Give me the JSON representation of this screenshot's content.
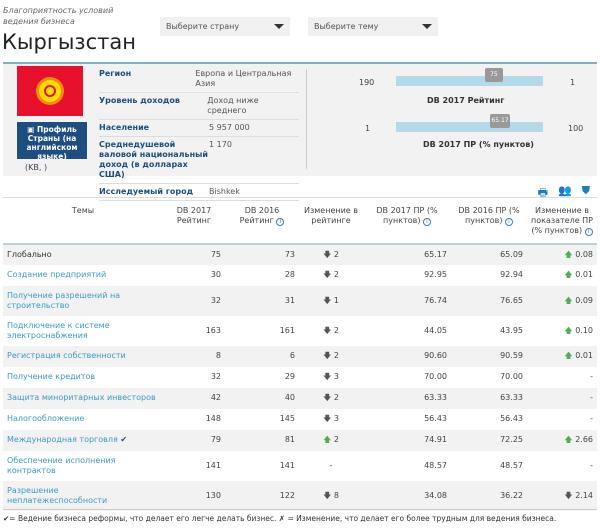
{
  "header": {
    "subtitle": "Благоприятность условий ведения бизнеса",
    "title": "Кыргызстан",
    "country_select": "Выберите страну",
    "topic_select": "Выберите тему"
  },
  "profile": {
    "button": "Профиль Страны (на английском языке)",
    "code": "(KB, )",
    "rows": [
      {
        "k": "Регион",
        "v": "Европа и Центральная Азия"
      },
      {
        "k": "Уровень доходов",
        "v": "Доход ниже среднего"
      },
      {
        "k": "Население",
        "v": "5 957 000"
      },
      {
        "k": "Среднедушевой валовой национальный доход (в долларах США)",
        "v": "1 170"
      },
      {
        "k": "Исследуемый город",
        "v": "Bishkek"
      }
    ]
  },
  "rank_bar": {
    "min": "190",
    "max": "1",
    "value": "75",
    "label": "DB 2017 Рейтинг"
  },
  "score_bar": {
    "min": "1",
    "max": "100",
    "value": "65.17",
    "label": "DB 2017 ПР (% пунктов)"
  },
  "table": {
    "headers": [
      "Темы",
      "DB 2017 Рейтинг",
      "DB 2016 Рейтинг",
      "Изменение в рейтинге",
      "DB 2017 ПР (% пунктов)",
      "DB 2016 ПР (% пунктов)",
      "Изменение в показателе ПР (% пунктов)"
    ],
    "rows": [
      {
        "t": "Глобально",
        "r17": "75",
        "r16": "73",
        "dir": "down",
        "ch": "2",
        "p17": "65.17",
        "p16": "65.09",
        "pdir": "up",
        "pch": "0.08"
      },
      {
        "t": "Создание предприятий",
        "r17": "30",
        "r16": "28",
        "dir": "down",
        "ch": "2",
        "p17": "92.95",
        "p16": "92.94",
        "pdir": "up",
        "pch": "0.01"
      },
      {
        "t": "Получение разрешений на строительство",
        "r17": "32",
        "r16": "31",
        "dir": "down",
        "ch": "1",
        "p17": "76.74",
        "p16": "76.65",
        "pdir": "up",
        "pch": "0.09"
      },
      {
        "t": "Подключение к системе электроснабжения",
        "r17": "163",
        "r16": "161",
        "dir": "down",
        "ch": "2",
        "p17": "44.05",
        "p16": "43.95",
        "pdir": "up",
        "pch": "0.10"
      },
      {
        "t": "Регистрация собственности",
        "r17": "8",
        "r16": "6",
        "dir": "down",
        "ch": "2",
        "p17": "90.60",
        "p16": "90.59",
        "pdir": "up",
        "pch": "0.01"
      },
      {
        "t": "Получение кредитов",
        "r17": "32",
        "r16": "29",
        "dir": "down",
        "ch": "3",
        "p17": "70.00",
        "p16": "70.00",
        "pdir": "",
        "pch": "-"
      },
      {
        "t": "Защита миноритарных инвесторов",
        "r17": "42",
        "r16": "40",
        "dir": "down",
        "ch": "2",
        "p17": "63.33",
        "p16": "63.33",
        "pdir": "",
        "pch": "-"
      },
      {
        "t": "Налогообложение",
        "r17": "148",
        "r16": "145",
        "dir": "down",
        "ch": "3",
        "p17": "56.43",
        "p16": "56.43",
        "pdir": "",
        "pch": "-"
      },
      {
        "t": "Международная торговля",
        "reform": "✔",
        "r17": "79",
        "r16": "81",
        "dir": "up",
        "ch": "2",
        "p17": "74.91",
        "p16": "72.25",
        "pdir": "up",
        "pch": "2.66"
      },
      {
        "t": "Обеспечение исполнения контрактов",
        "r17": "141",
        "r16": "141",
        "dir": "",
        "ch": "-",
        "p17": "48.57",
        "p16": "48.57",
        "pdir": "",
        "pch": "-"
      },
      {
        "t": "Разрешение неплатежеспособности",
        "r17": "130",
        "r16": "122",
        "dir": "down",
        "ch": "8",
        "p17": "34.08",
        "p16": "36.22",
        "pdir": "down",
        "pch": "2.14"
      }
    ]
  },
  "footer": "✔= Ведение бизнеса реформы, что делает его легче делать бизнес. ✗ = Изменение, что делает его более трудным для ведения бизнеса."
}
